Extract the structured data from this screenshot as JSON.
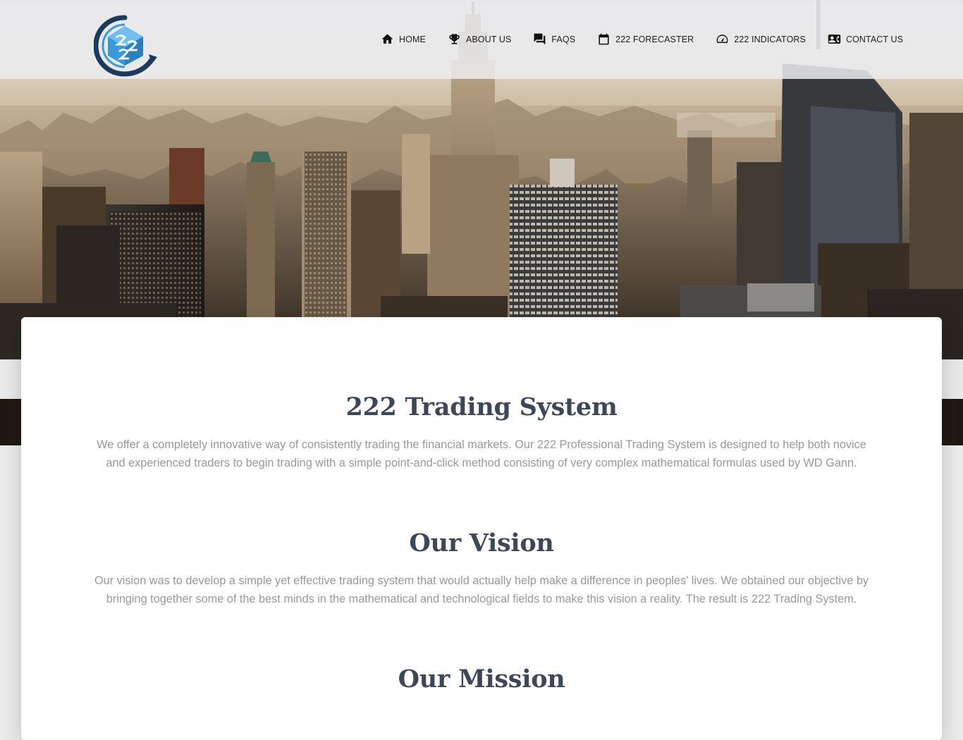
{
  "header": {
    "logo_alt": "222 Trading System logo",
    "nav": [
      {
        "label": "HOME",
        "icon": "home-icon"
      },
      {
        "label": "ABOUT US",
        "icon": "trophy-icon"
      },
      {
        "label": "FAQS",
        "icon": "forum-icon"
      },
      {
        "label": "222 FORECASTER",
        "icon": "calendar-icon"
      },
      {
        "label": "222 INDICATORS",
        "icon": "speedometer-icon"
      },
      {
        "label": "CONTACT US",
        "icon": "contact-card-icon"
      }
    ]
  },
  "sections": [
    {
      "title": "222 Trading System",
      "body": "We offer a completely innovative way of consistently trading the financial markets. Our 222 Professional Trading System is designed to help both novice and experienced traders to begin trading with a simple point-and-click method consisting of very complex mathematical formulas used by WD Gann."
    },
    {
      "title": "Our Vision",
      "body": "Our vision was to develop a simple yet effective trading system that would actually help make a difference in peoples’ lives. We obtained our objective by bringing together some of the best minds in the mathematical and technological fields to make this vision a reality. The result is 222 Trading System."
    },
    {
      "title": "Our Mission",
      "body": ""
    }
  ],
  "colors": {
    "heading": "#3c4858",
    "body_text": "#999999",
    "logo_blue": "#3a9ad9",
    "logo_navy": "#1c3a5e"
  }
}
